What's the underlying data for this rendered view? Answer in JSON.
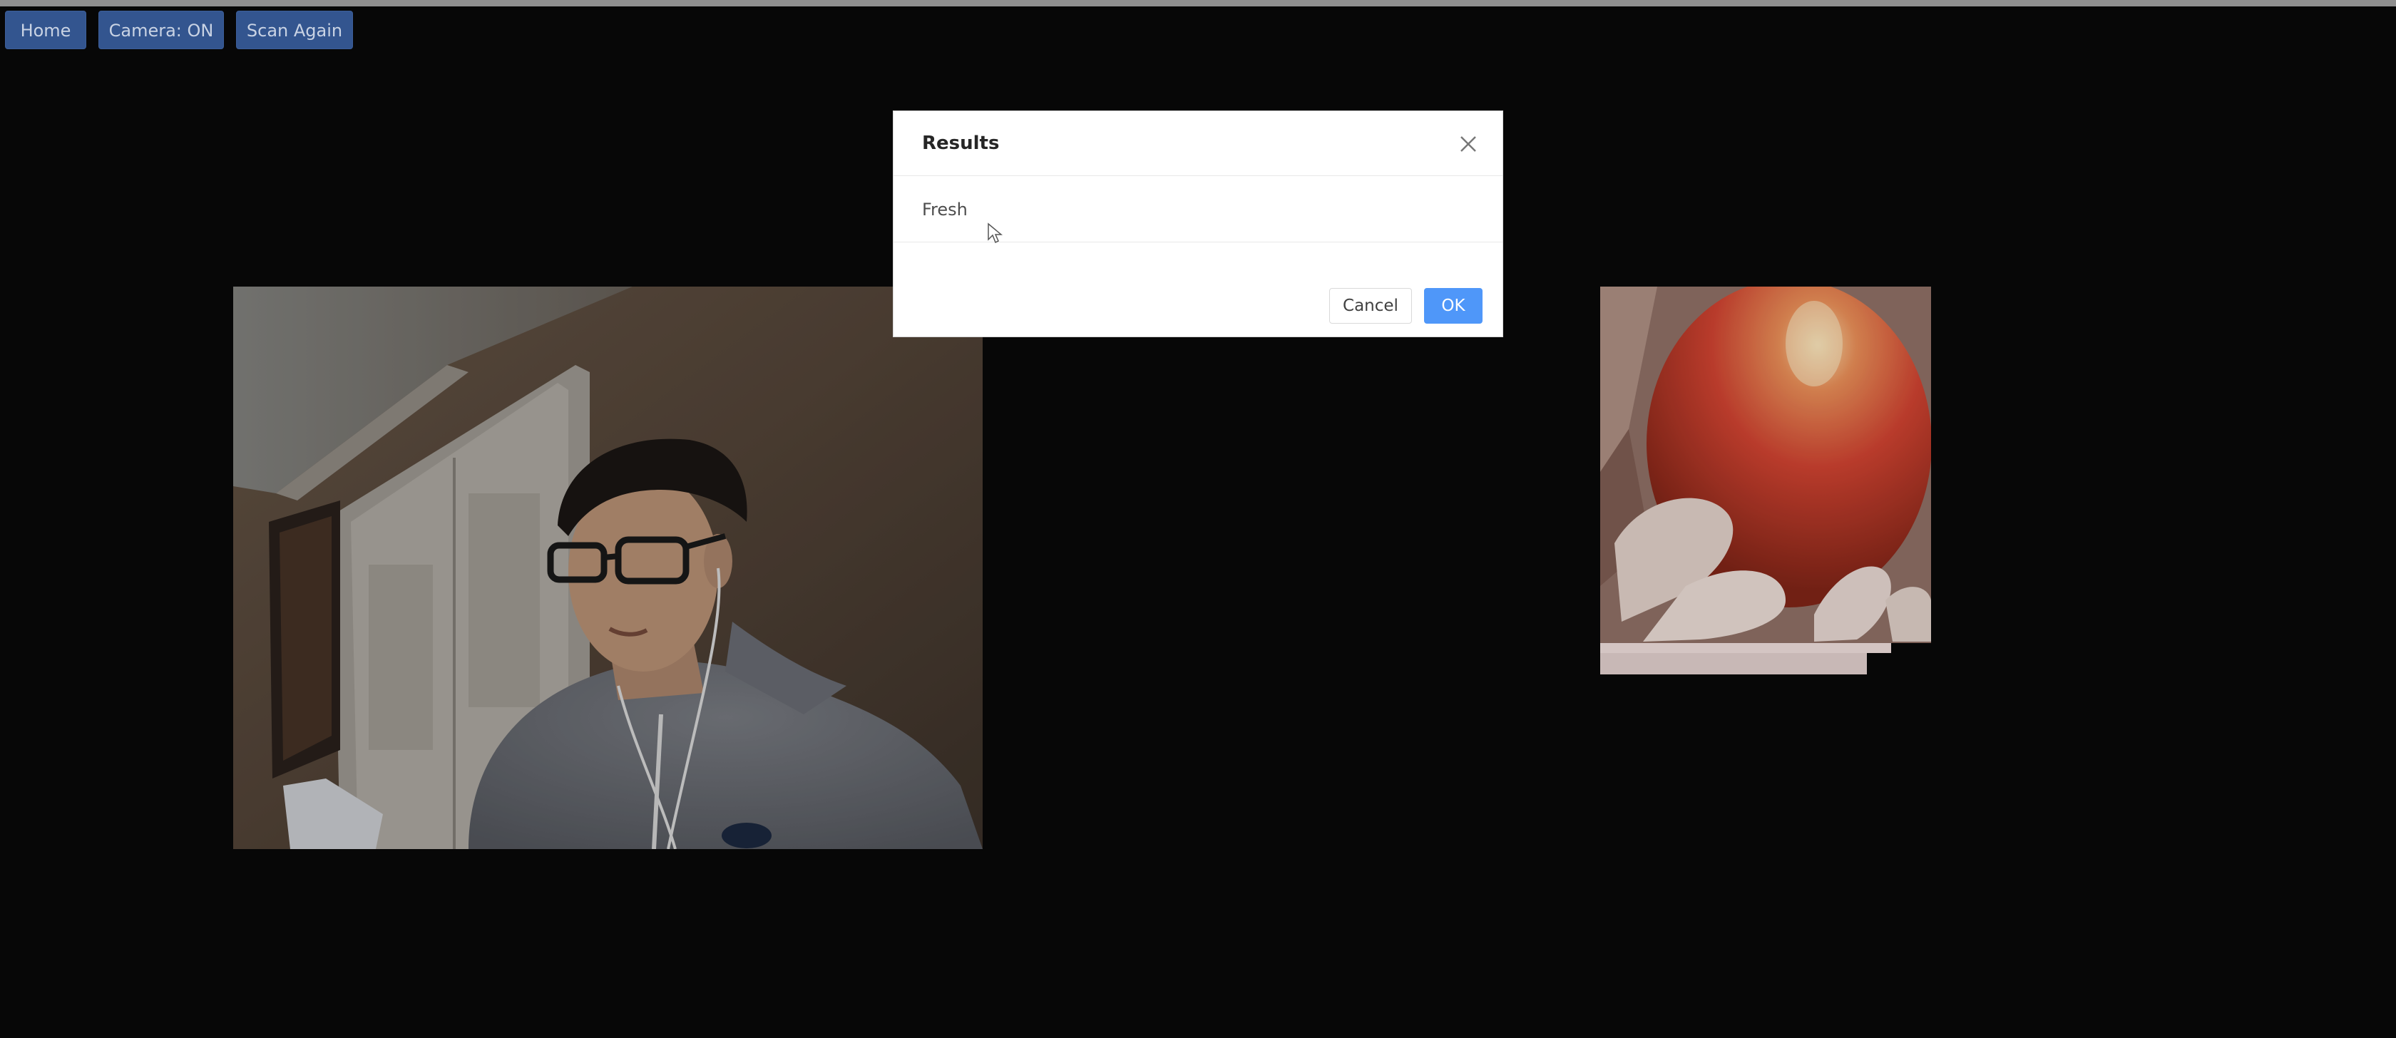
{
  "toolbar": {
    "home_label": "Home",
    "camera_label": "Camera: ON",
    "scan_label": "Scan Again"
  },
  "modal": {
    "title": "Results",
    "result": "Fresh",
    "cancel_label": "Cancel",
    "ok_label": "OK"
  },
  "colors": {
    "background": "#070707",
    "toolbar_button": "#33558f",
    "primary_button": "#4f97f9"
  },
  "icons": {
    "close": "close-icon",
    "cursor": "mouse-pointer-icon"
  }
}
